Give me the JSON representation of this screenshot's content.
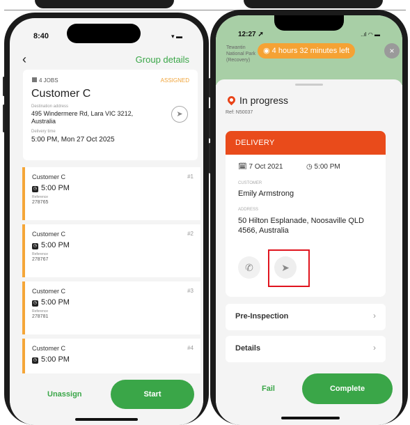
{
  "left_phone": {
    "status": {
      "time": "8:40",
      "icons": "▾ ▬"
    },
    "header": {
      "back_icon": "‹",
      "title": "Group details"
    },
    "summary": {
      "jobs_count": "4 JOBS",
      "status_badge": "ASSIGNED",
      "customer": "Customer C",
      "destination_label": "Destination address",
      "destination": "495 Windermere Rd, Lara VIC 3212, Australia",
      "delivery_label": "Delivery time",
      "delivery": "5:00 PM, Mon 27 Oct 2025"
    },
    "jobs": [
      {
        "name": "Customer C",
        "number": "#1",
        "time": "5:00 PM",
        "ref_label": "Reference",
        "ref": "278765"
      },
      {
        "name": "Customer C",
        "number": "#2",
        "time": "5:00 PM",
        "ref_label": "Reference",
        "ref": "278767"
      },
      {
        "name": "Customer C",
        "number": "#3",
        "time": "5:00 PM",
        "ref_label": "Reference",
        "ref": "278781"
      },
      {
        "name": "Customer C",
        "number": "#4",
        "time": "5:00 PM"
      }
    ],
    "footer": {
      "unassign": "Unassign",
      "start": "Start"
    }
  },
  "right_phone": {
    "status": {
      "time": "12:27 ➚",
      "icons": "..ıl ◠ ▬"
    },
    "map_label": "Tewantin National Park (Recovery)",
    "timer": "4 hours 32 minutes left",
    "close_icon": "×",
    "state": "In progress",
    "ref": "Ref: N50037",
    "delivery": {
      "header": "DELIVERY",
      "date": "7 Oct 2021",
      "time": "5:00 PM",
      "customer_label": "CUSTOMER",
      "customer": "Emily Armstrong",
      "address_label": "ADDRESS",
      "address": "50 Hilton Esplanade, Noosaville QLD 4566, Australia"
    },
    "rows": [
      {
        "label": "Pre-Inspection",
        "chevron": "›"
      },
      {
        "label": "Details",
        "chevron": "›"
      }
    ],
    "footer": {
      "fail": "Fail",
      "complete": "Complete"
    }
  },
  "colors": {
    "green": "#3aa648",
    "orange": "#f5a638",
    "red": "#e94b1b",
    "highlight": "#e0141e"
  }
}
